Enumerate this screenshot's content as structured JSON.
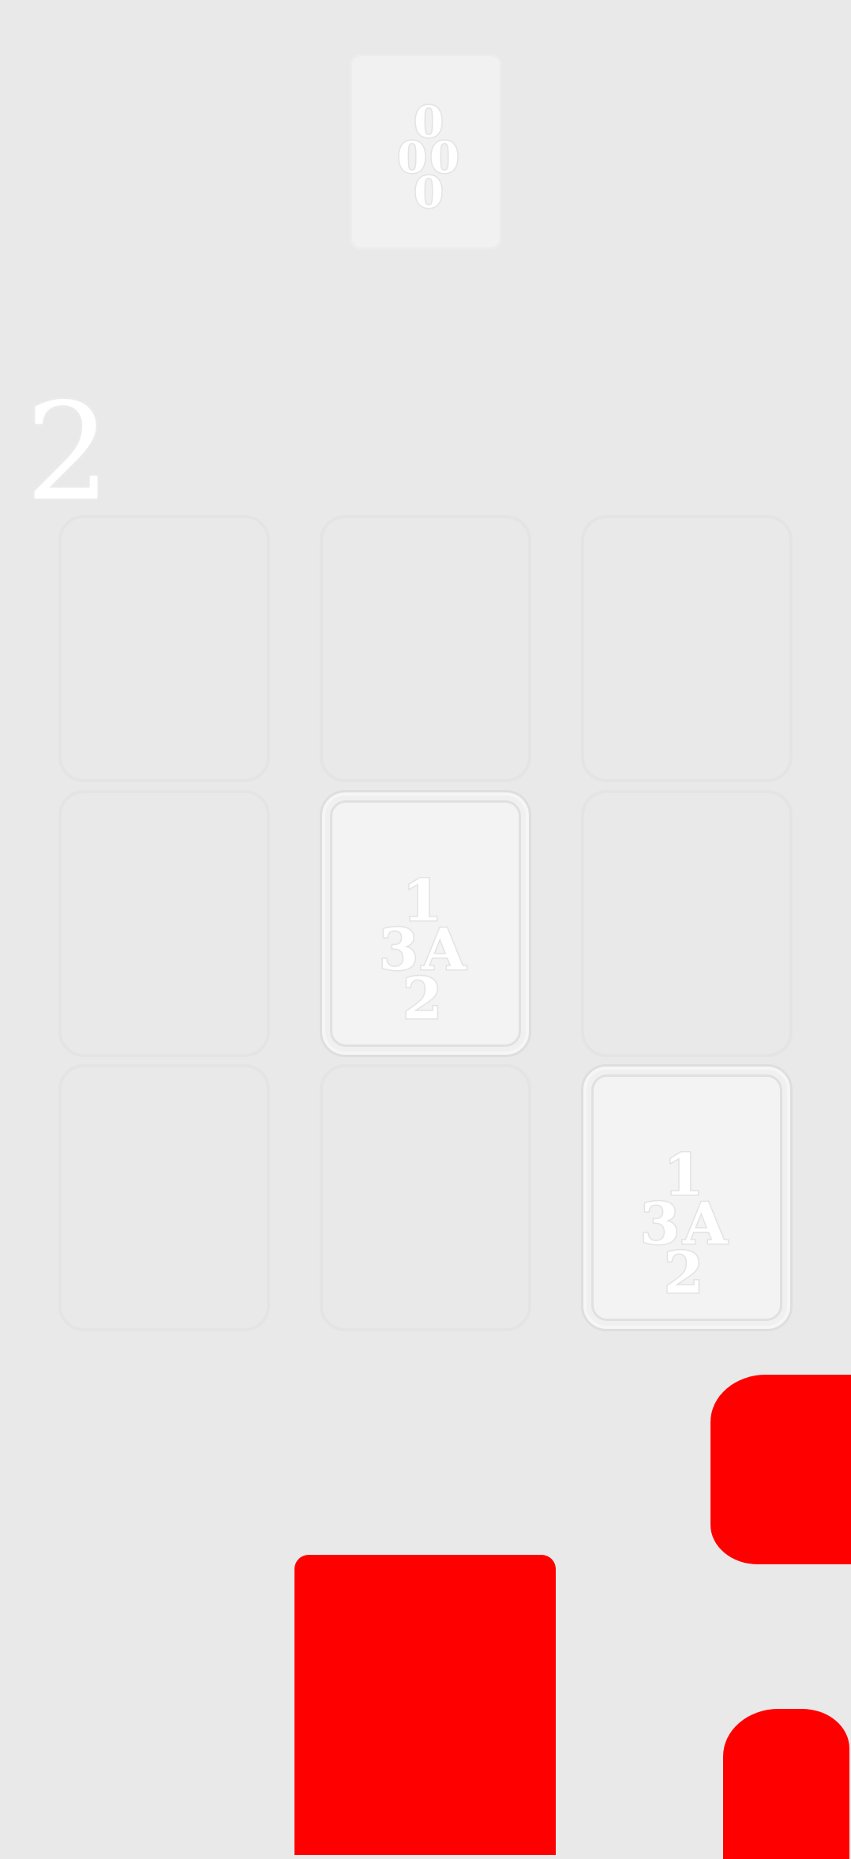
{
  "top_card": {
    "glyphs": {
      "top": "0",
      "left": "0",
      "right": "0",
      "bottom": "0"
    }
  },
  "score": "2",
  "board": {
    "rows": 3,
    "cols": 3,
    "cells": [
      {
        "filled": false
      },
      {
        "filled": false
      },
      {
        "filled": false
      },
      {
        "filled": false
      },
      {
        "filled": true,
        "glyphs": {
          "top": "1",
          "left": "3",
          "right": "A",
          "bottom": "2"
        }
      },
      {
        "filled": false
      },
      {
        "filled": false
      },
      {
        "filled": false
      },
      {
        "filled": true,
        "glyphs": {
          "top": "1",
          "left": "3",
          "right": "A",
          "bottom": "2"
        }
      }
    ]
  },
  "colors": {
    "background": "#e9e9e9",
    "card": "#f1f1f1",
    "accent_red": "#ff0000"
  }
}
